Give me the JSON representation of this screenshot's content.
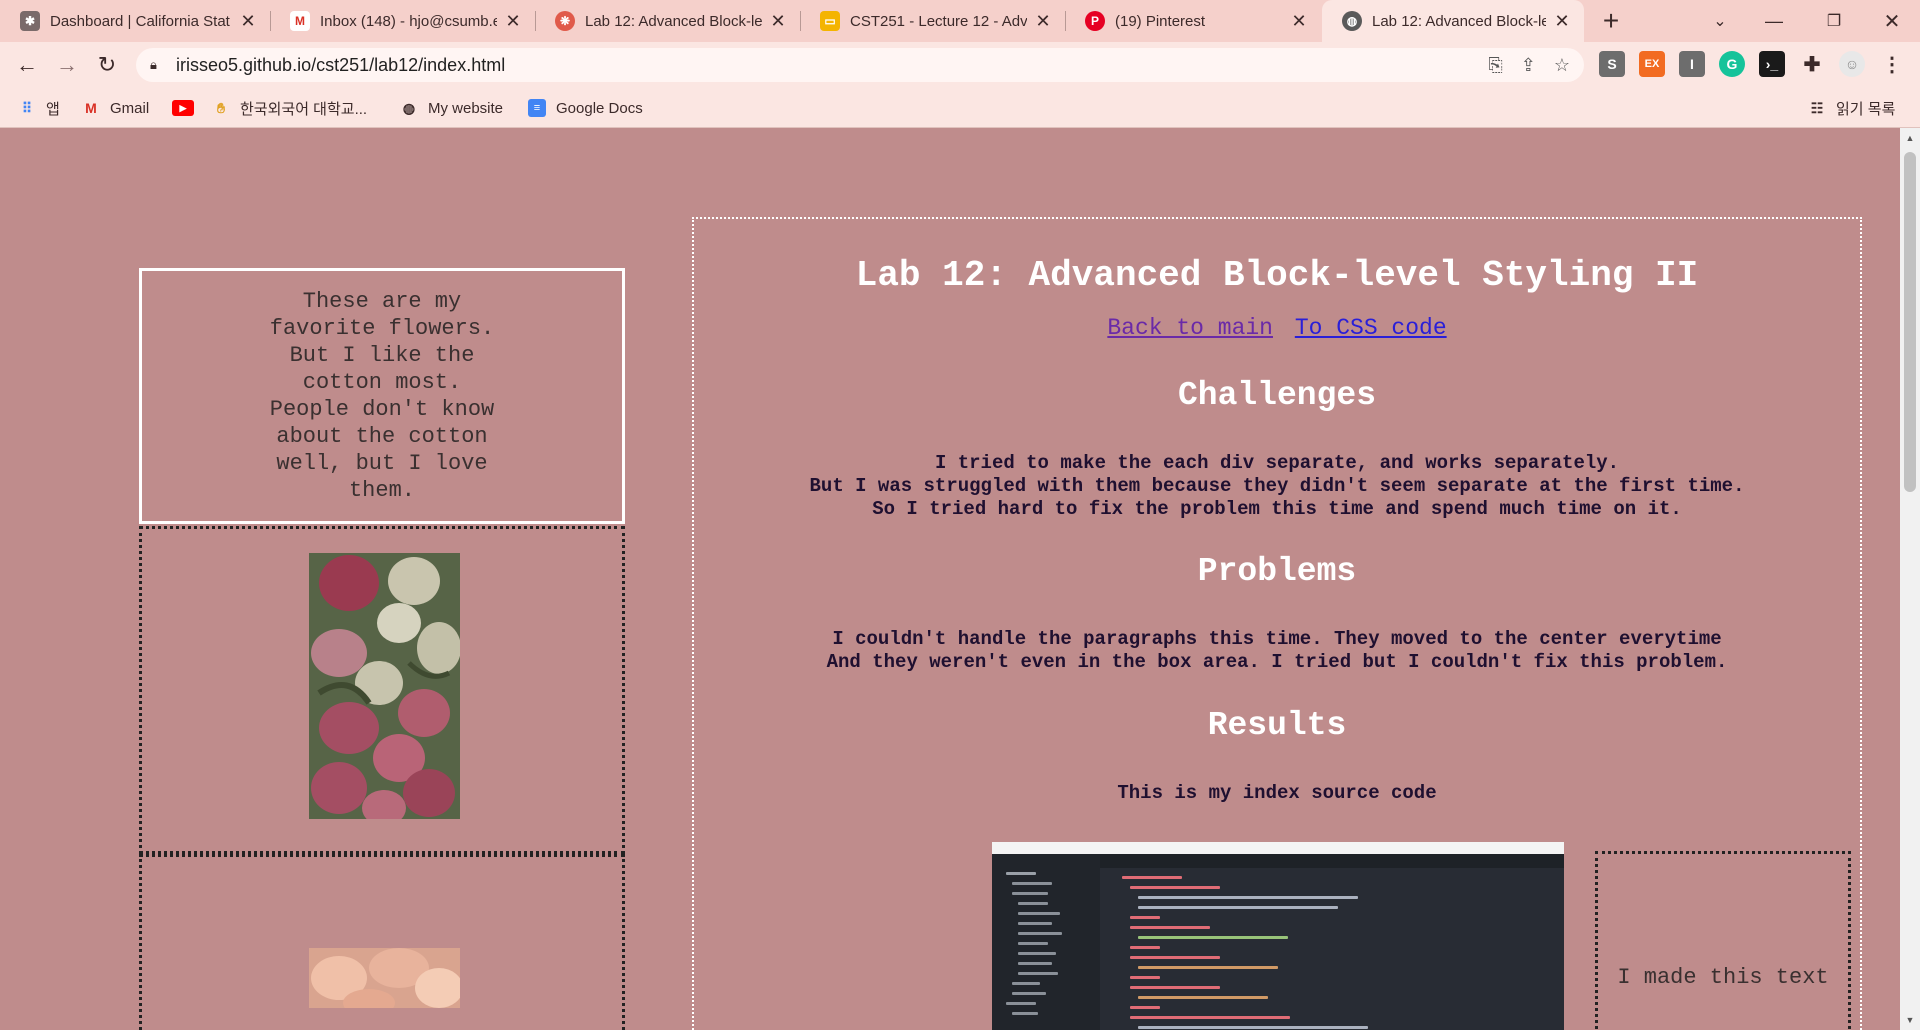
{
  "browser": {
    "tabs": [
      {
        "title": "Dashboard | California Stat",
        "icon": "canvas-icon"
      },
      {
        "title": "Inbox (148) - hjo@csumb.e",
        "icon": "gmail-icon"
      },
      {
        "title": "Lab 12: Advanced Block-le",
        "icon": "lab-icon"
      },
      {
        "title": "CST251 - Lecture 12 - Adv",
        "icon": "slides-icon"
      },
      {
        "title": "(19) Pinterest",
        "icon": "pinterest-icon"
      },
      {
        "title": "Lab 12: Advanced Block-le",
        "icon": "globe-icon",
        "active": true
      }
    ],
    "url": "irisseo5.github.io/cst251/lab12/index.html",
    "bookmarks": [
      {
        "label": "앱",
        "icon": "apps-grid-icon"
      },
      {
        "label": "Gmail",
        "icon": "gmail-icon"
      },
      {
        "label": "",
        "icon": "youtube-icon"
      },
      {
        "label": "한국외국어 대학교...",
        "icon": "hufs-icon"
      },
      {
        "label": "My website",
        "icon": "globe-icon"
      },
      {
        "label": "Google Docs",
        "icon": "docs-icon"
      }
    ],
    "reading_list": "읽기 목록"
  },
  "page": {
    "favorite_text": "These are my favorite flowers. But I like the cotton most. People don't know about the cotton well, but I love them.",
    "title": "Lab 12: Advanced Block-level Styling II",
    "links": {
      "back": "Back to main",
      "css": "To CSS code"
    },
    "sections": [
      {
        "heading": "Challenges",
        "lines": [
          "I tried to make the each div separate, and works separately.",
          "But I was struggled with them because they didn't seem separate at the first time.",
          "So I tried hard to fix the problem this time and spend much time on it."
        ]
      },
      {
        "heading": "Problems",
        "lines": [
          "I couldn't handle the paragraphs this time. They moved to the center everytime",
          "And they weren't even in the box area. I tried but I couldn't fix this problem."
        ]
      },
      {
        "heading": "Results",
        "lines": [
          "This is my index source code"
        ]
      }
    ],
    "made_text": "I made this text"
  },
  "colors": {
    "page_bg": "#bf8c8c",
    "tab_strip": "#f5d0cb",
    "toolbar": "#fbe6e2",
    "link": "#2a1fd8",
    "visited_link": "#6a2aa8"
  }
}
